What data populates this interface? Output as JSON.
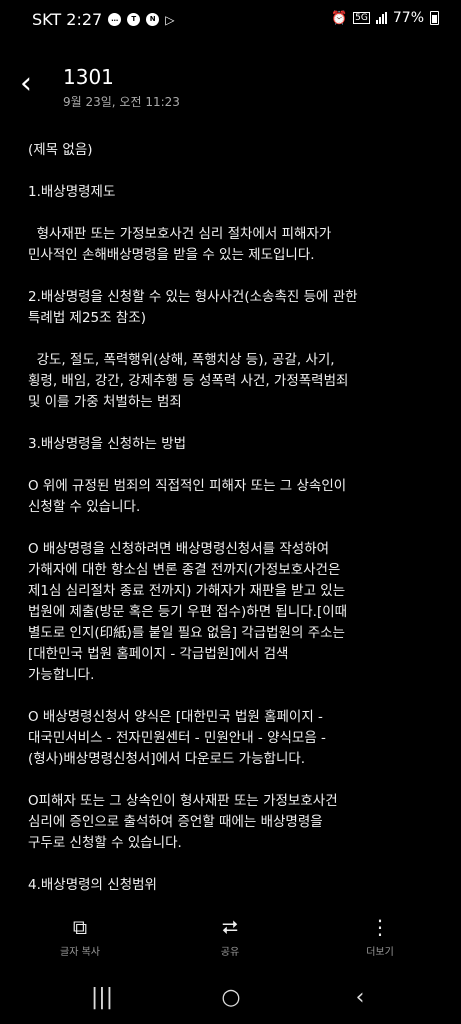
{
  "status_bar": {
    "carrier_time": "SKT 2:27",
    "icons_left": [
      "chat-icon",
      "talk-icon",
      "n-icon",
      "play-icon"
    ],
    "network": "5G",
    "battery": "77%"
  },
  "header": {
    "title": "1301",
    "date": "9월 23일, 오전 11:23"
  },
  "note": {
    "lines": [
      "(제목 없음)",
      "",
      "1.배상명령제도",
      "",
      "  형사재판 또는 가정보호사건 심리 절차에서 피해자가",
      "민사적인 손해배상명령을 받을 수 있는 제도입니다.",
      "",
      "2.배상명령을 신청할 수 있는 형사사건(소송촉진 등에 관한",
      "특례법 제25조 참조)",
      "",
      "  강도, 절도, 폭력행위(상해, 폭행치상 등), 공갈, 사기,",
      "횡령, 배임, 강간, 강제추행 등 성폭력 사건, 가정폭력범죄",
      "및 이를 가중 처벌하는 범죄",
      "",
      "3.배상명령을 신청하는 방법",
      "",
      "O 위에 규정된 범죄의 직접적인 피해자 또는 그 상속인이",
      "신청할 수 있습니다.",
      "",
      "O 배상명령을 신청하려면 배상명령신청서를 작성하여",
      "가해자에 대한 항소심 변론 종결 전까지(가정보호사건은",
      "제1심 심리절차 종료 전까지) 가해자가 재판을 받고 있는",
      "법원에 제출(방문 혹은 등기 우편 접수)하면 됩니다.[이때",
      "별도로 인지(印紙)를 붙일 필요 없음] 각급법원의 주소는",
      "[대한민국 법원 홈페이지 - 각급법원]에서 검색",
      "가능합니다.",
      "",
      "O 배상명령신청서 양식은 [대한민국 법원 홈페이지 -",
      "대국민서비스 - 전자민원센터 - 민원안내 - 양식모음 -",
      "(형사)배상명령신청서]에서 다운로드 가능합니다.",
      "",
      "O피해자 또는 그 상속인이 형사재판 또는 가정보호사건",
      "심리에 증인으로 출석하여 증언할 때에는 배상명령을",
      "구두로 신청할 수 있습니다.",
      "",
      "4.배상명령의 신청범위"
    ]
  },
  "actions": {
    "copy_label": "글자 복사",
    "share_label": "공유",
    "more_label": "더보기"
  }
}
